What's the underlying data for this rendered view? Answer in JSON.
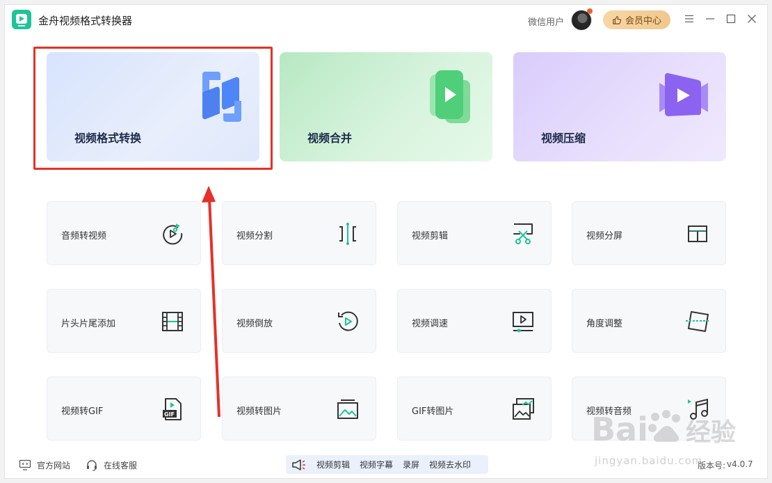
{
  "app": {
    "title": "金舟视频格式转换器"
  },
  "header": {
    "user_name": "微信用户",
    "vip_label": "会员中心"
  },
  "features": [
    {
      "label": "视频格式转换",
      "color": "#4f86f7"
    },
    {
      "label": "视频合并",
      "color": "#3fcf74"
    },
    {
      "label": "视频压缩",
      "color": "#8b63f0"
    }
  ],
  "tools": [
    {
      "label": "音频转视频",
      "icon": "audio-to-video-icon"
    },
    {
      "label": "视频分割",
      "icon": "split-icon"
    },
    {
      "label": "视频剪辑",
      "icon": "scissors-icon"
    },
    {
      "label": "视频分屏",
      "icon": "split-screen-icon"
    },
    {
      "label": "片头片尾添加",
      "icon": "film-icon"
    },
    {
      "label": "视频倒放",
      "icon": "rewind-icon"
    },
    {
      "label": "视频调速",
      "icon": "speed-icon"
    },
    {
      "label": "角度调整",
      "icon": "rotate-icon"
    },
    {
      "label": "视频转GIF",
      "icon": "gif-icon"
    },
    {
      "label": "视频转图片",
      "icon": "image-icon"
    },
    {
      "label": "GIF转图片",
      "icon": "gif-to-image-icon"
    },
    {
      "label": "视频转音频",
      "icon": "music-icon"
    }
  ],
  "footer": {
    "website": "官方网站",
    "support": "在线客服",
    "promo": [
      "视频剪辑",
      "视频字幕",
      "录屏",
      "视频去水印"
    ],
    "version_label": "版本号:",
    "version": "v4.0.7"
  },
  "watermark": {
    "brand": "Bai",
    "brand2": "经验",
    "url": "jingyan.baidu.com"
  },
  "colors": {
    "accent": "#1dc49a",
    "annotation": "#e53127",
    "vip": "#f0c88e"
  }
}
